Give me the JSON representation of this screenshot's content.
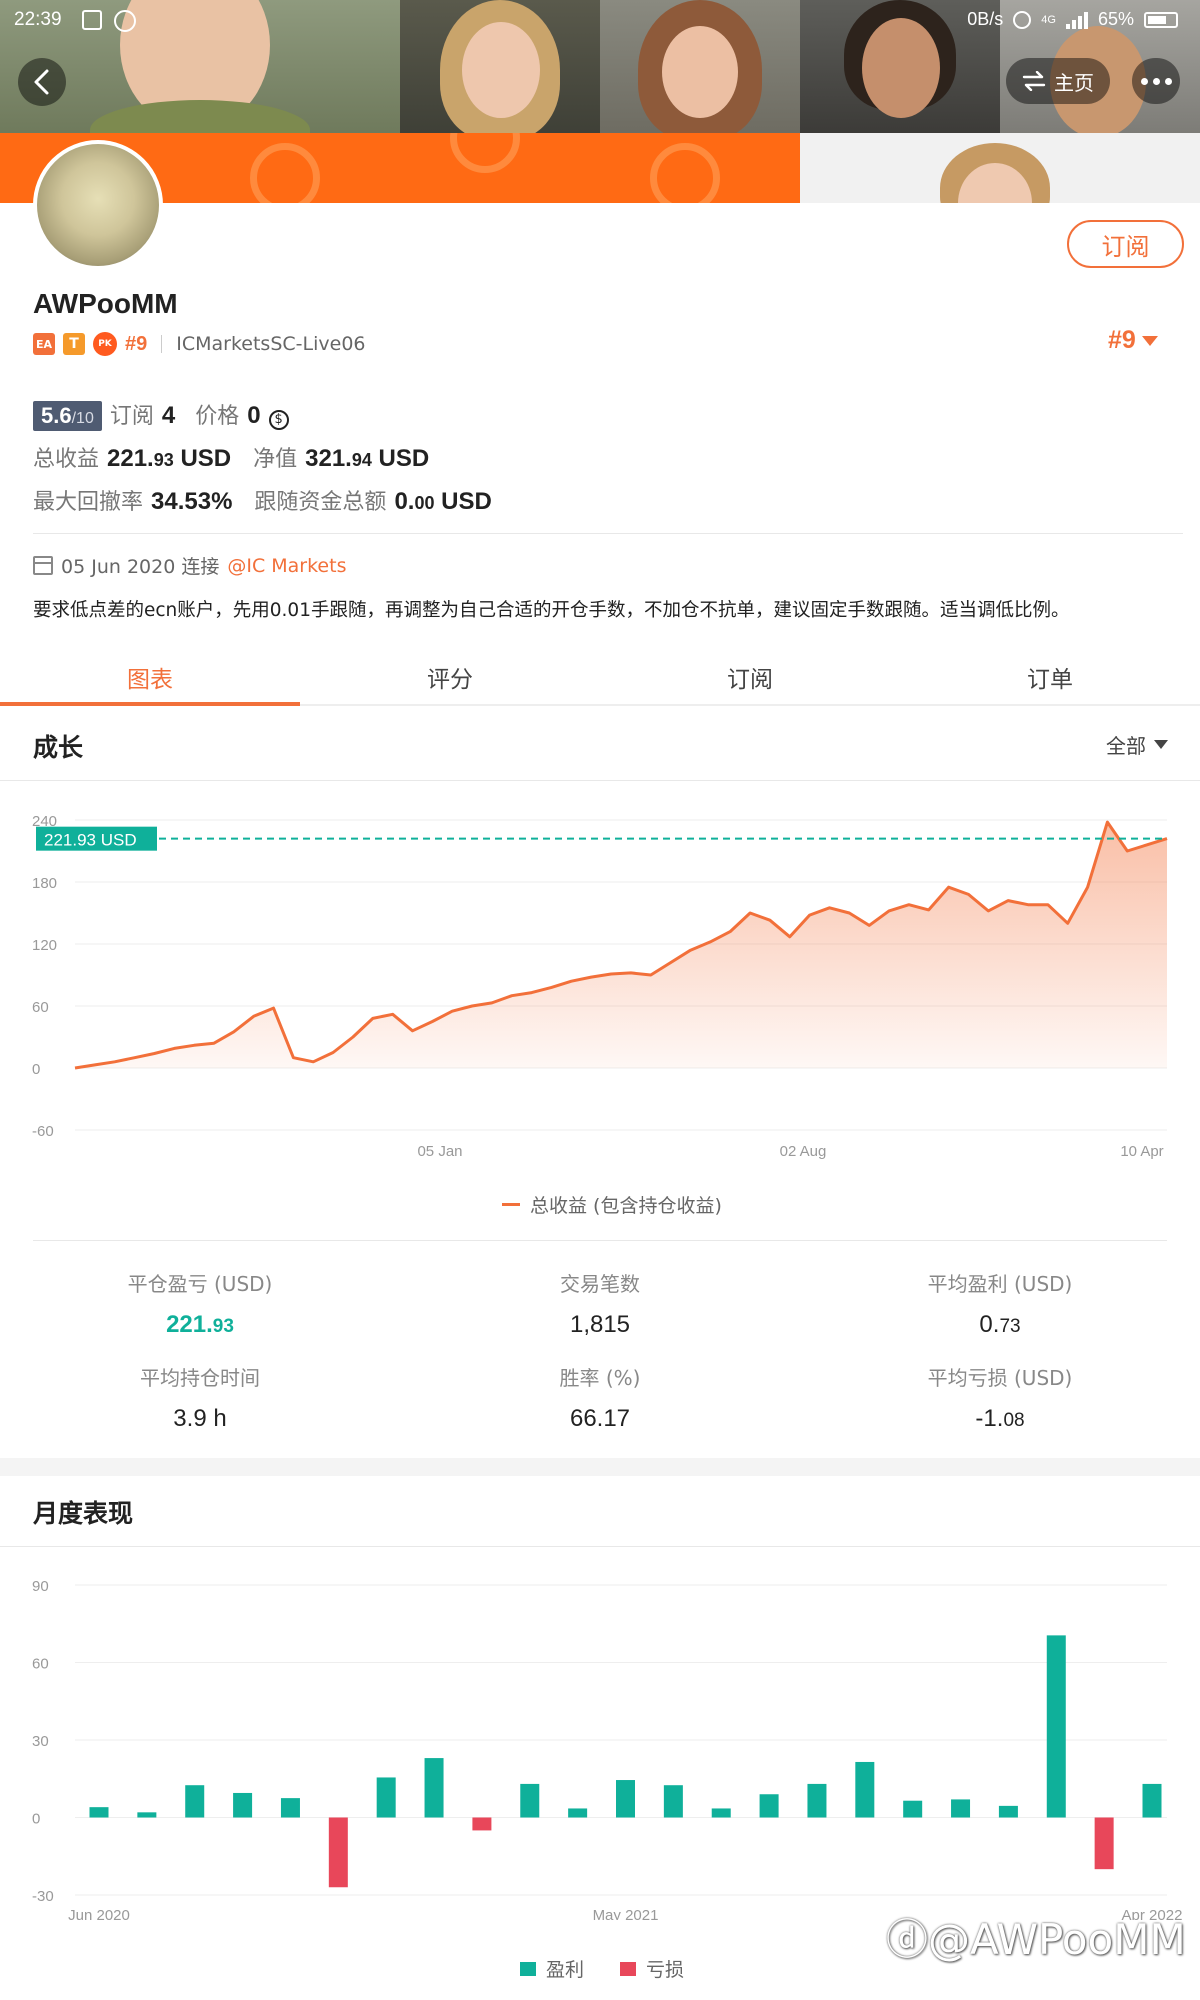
{
  "status_bar": {
    "time": "22:39",
    "network_speed": "0B/s",
    "signal_label": "4G",
    "battery": "65%"
  },
  "header": {
    "home_label": "主页",
    "subscribe_label": "订阅"
  },
  "profile": {
    "username": "AWPooMM",
    "badge_ea": "EA",
    "badge_t": "T",
    "badge_pk": "PK",
    "rank": "#9",
    "server": "ICMarketsSC-Live06",
    "rank_right": "#9",
    "score_main": "5.6",
    "score_total": "/10",
    "subscriptions_label": "订阅",
    "subscriptions_value": "4",
    "price_label": "价格",
    "price_value": "0",
    "price_icon": "coin-icon",
    "total_profit_label": "总收益",
    "total_profit_int": "221.",
    "total_profit_dec": "93",
    "total_profit_unit": "USD",
    "equity_label": "净值",
    "equity_int": "321.",
    "equity_dec": "94",
    "equity_unit": "USD",
    "max_drawdown_label": "最大回撤率",
    "max_drawdown_value": "34.53%",
    "follow_funds_label": "跟随资金总额",
    "follow_funds_int": "0.",
    "follow_funds_dec": "00",
    "follow_funds_unit": "USD",
    "connected_date": "05 Jun 2020 连接",
    "broker": "@IC Markets",
    "description": "要求低点差的ecn账户，先用0.01手跟随，再调整为自己合适的开仓手数，不加仓不抗单，建议固定手数跟随。适当调低比例。"
  },
  "tabs": [
    {
      "label": "图表",
      "active": true
    },
    {
      "label": "评分",
      "active": false
    },
    {
      "label": "订阅",
      "active": false
    },
    {
      "label": "订单",
      "active": false
    }
  ],
  "growth": {
    "title": "成长",
    "range_label": "全部",
    "current_value_label": "221.93 USD",
    "legend_label": "总收益 (包含持仓收益)"
  },
  "summary_stats": [
    {
      "label": "平仓盈亏 (USD)",
      "value_int": "221.",
      "value_dec": "93",
      "highlight": true
    },
    {
      "label": "交易笔数",
      "value_int": "1,815",
      "value_dec": "",
      "highlight": false
    },
    {
      "label": "平均盈利 (USD)",
      "value_int": "0.",
      "value_dec": "73",
      "highlight": false
    },
    {
      "label": "平均持仓时间",
      "value_int": "3.9 h",
      "value_dec": "",
      "highlight": false
    },
    {
      "label": "胜率 (%)",
      "value_int": "66.17",
      "value_dec": "",
      "highlight": false
    },
    {
      "label": "平均亏损 (USD)",
      "value_int": "-1.",
      "value_dec": "08",
      "highlight": false
    }
  ],
  "monthly": {
    "title": "月度表现",
    "legend_profit": "盈利",
    "legend_loss": "亏损"
  },
  "watermark": "@AWPooMM",
  "colors": {
    "accent": "#f2703a",
    "profit": "#0fb09a",
    "loss": "#e8475a",
    "banner": "#ff6a14"
  },
  "chart_data": [
    {
      "type": "area",
      "title": "成长",
      "series": [
        {
          "name": "总收益 (包含持仓收益)",
          "values": [
            0,
            3,
            6,
            10,
            14,
            19,
            22,
            24,
            35,
            50,
            58,
            10,
            6,
            15,
            30,
            48,
            52,
            36,
            45,
            55,
            60,
            63,
            70,
            73,
            78,
            84,
            88,
            91,
            92,
            90,
            102,
            114,
            122,
            132,
            150,
            143,
            127,
            148,
            155,
            150,
            138,
            152,
            158,
            153,
            175,
            168,
            152,
            162,
            158,
            158,
            140,
            175,
            238,
            210,
            216,
            222
          ]
        }
      ],
      "x_tick_labels": [
        "05 Jan",
        "02 Aug",
        "10 Apr"
      ],
      "y_ticks": [
        -60,
        0,
        60,
        120,
        180,
        240
      ],
      "ylim": [
        -60,
        240
      ],
      "current_value": 221.93,
      "grid": true,
      "legend_position": "bottom"
    },
    {
      "type": "bar",
      "title": "月度表现",
      "categories": [
        "Jun 2020",
        "",
        "",
        "",
        "",
        "",
        "",
        "",
        "",
        "",
        "",
        "May 2021",
        "",
        "",
        "",
        "",
        "",
        "",
        "",
        "",
        "",
        "",
        "Apr 2022"
      ],
      "values": [
        4,
        2,
        12.5,
        9.5,
        7.5,
        -27,
        15.5,
        23,
        -5,
        13,
        3.5,
        14.5,
        12.5,
        3.5,
        9,
        13,
        21.5,
        6.5,
        7,
        4.5,
        70.5,
        -20,
        13
      ],
      "y_ticks": [
        -30,
        0,
        30,
        60,
        90
      ],
      "ylim": [
        -30,
        90
      ],
      "grid": true,
      "legend_position": "bottom",
      "series_labels": [
        "盈利",
        "亏损"
      ]
    }
  ]
}
